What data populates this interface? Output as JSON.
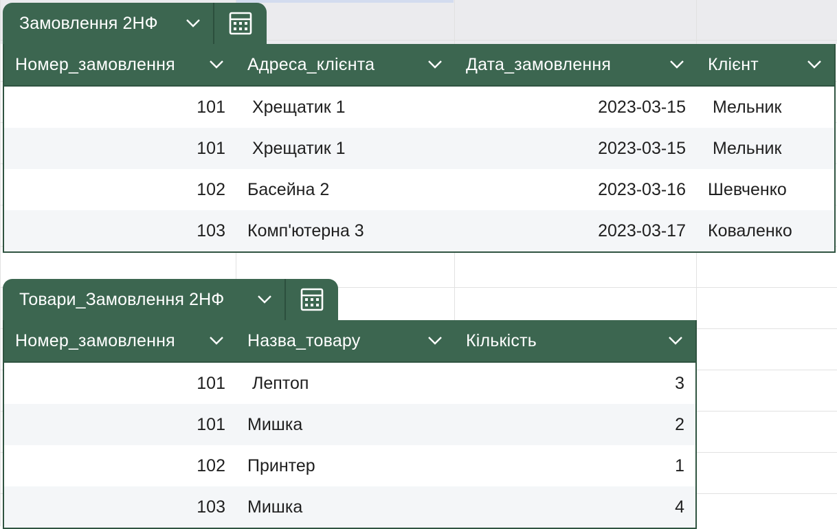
{
  "tables": [
    {
      "name": "Замовлення 2НФ",
      "columns": [
        "Номер_замовлення",
        "Адреса_клієнта",
        "Дата_замовлення",
        "Клієнт"
      ],
      "rows": [
        [
          "101",
          " Хрещатик 1",
          "2023-03-15",
          " Мельник"
        ],
        [
          "101",
          " Хрещатик 1",
          "2023-03-15",
          " Мельник"
        ],
        [
          "102",
          "Басейна 2",
          "2023-03-16",
          "Шевченко"
        ],
        [
          "103",
          "Комп'ютерна 3",
          "2023-03-17",
          "Коваленко"
        ]
      ]
    },
    {
      "name": "Товари_Замовлення 2НФ",
      "columns": [
        "Номер_замовлення",
        "Назва_товару",
        "Кількість"
      ],
      "rows": [
        [
          "101",
          " Лептоп",
          "3"
        ],
        [
          "101",
          "Мишка",
          "2"
        ],
        [
          "102",
          "Принтер",
          "1"
        ],
        [
          "103",
          "Мишка",
          "4"
        ]
      ]
    }
  ],
  "icons": {
    "dropdown": "chevron-down-icon",
    "calculator": "calculator-icon"
  },
  "colors": {
    "header_bg": "#3c6650",
    "header_text": "#ffffff",
    "alt_row_bg": "#f4f6f8",
    "border": "#2f5340"
  }
}
